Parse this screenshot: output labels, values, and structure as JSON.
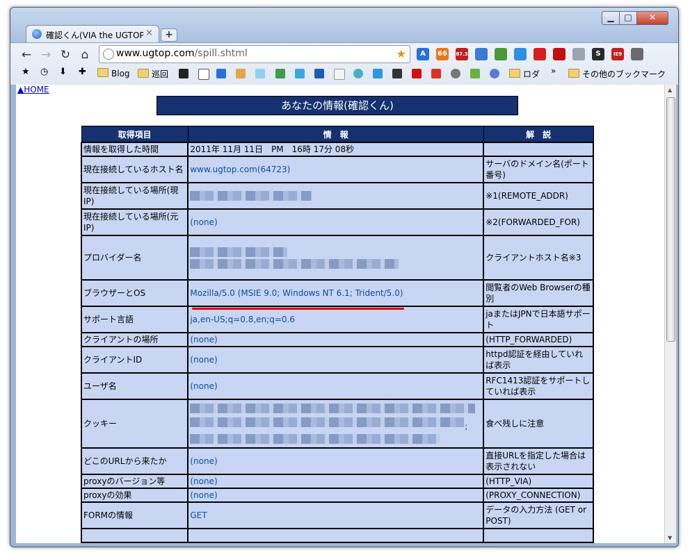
{
  "tab": {
    "title": "確認くん(VIA the UGTOP",
    "close": "×",
    "new": "+"
  },
  "window": {
    "min": "▁",
    "max": "□",
    "close": "✕"
  },
  "nav": {
    "back": "←",
    "forward": "→",
    "reload": "↻",
    "home": "⌂"
  },
  "address": {
    "domain": "www.ugtop.com",
    "path": "/spill.shtml"
  },
  "extensions": [
    {
      "icon": "translate-icon",
      "color": "#2a6fd1",
      "text": "A"
    },
    {
      "icon": "rss-icon",
      "color": "#e8771c",
      "text": "66"
    },
    {
      "icon": "count-icon",
      "color": "#c02020",
      "text": "87.3"
    },
    {
      "icon": "screenshot-icon",
      "color": "#3a7bd5",
      "text": ""
    },
    {
      "icon": "share-icon",
      "color": "#4a9a3a",
      "text": ""
    },
    {
      "icon": "sync-icon",
      "color": "#2f8fe0",
      "text": ""
    },
    {
      "icon": "opera-icon",
      "color": "#d62020",
      "text": ""
    },
    {
      "icon": "adblock-icon",
      "color": "#c01010",
      "text": ""
    },
    {
      "icon": "magnifier-icon",
      "color": "#9aa4b0",
      "text": ""
    },
    {
      "icon": "s-icon",
      "color": "#2a2a2a",
      "text": "S"
    },
    {
      "icon": "ie9-icon",
      "color": "#c42020",
      "text": "IE9"
    },
    {
      "icon": "wrench-icon",
      "color": "#6b6b6b",
      "text": ""
    }
  ],
  "bookmarks": {
    "blog": "Blog",
    "junkai": "巡回",
    "roda": "ロダ",
    "more": "»",
    "other": "その他のブックマーク"
  },
  "page": {
    "home_link": "▲HOME",
    "banner": "あなたの情報(確認くん)",
    "headers": [
      "取得項目",
      "情　報",
      "解　説"
    ],
    "rows": [
      {
        "item": "情報を取得した時間",
        "value": "2011年 11月 11日　PM　16時 17分 08秒",
        "desc": ""
      },
      {
        "item": "現在接続しているホスト名",
        "value": "www.ugtop.com(64723)",
        "desc": "サーバのドメイン名(ポート番号)"
      },
      {
        "item": "現在接続している場所(現IP)",
        "value": "",
        "desc": "※1(REMOTE_ADDR)"
      },
      {
        "item": "現在接続している場所(元IP)",
        "value": "(none)",
        "desc": "※2(FORWARDED_FOR)"
      },
      {
        "item": "プロバイダー名",
        "value": "",
        "desc": "クライアントホスト名※3"
      },
      {
        "item": "ブラウザーとOS",
        "value": "Mozilla/5.0 (MSIE 9.0; Windows NT 6.1; Trident/5.0)",
        "desc": "閲覧者のWeb Browserの種別"
      },
      {
        "item": "サポート言語",
        "value": "ja,en-US;q=0.8,en;q=0.6",
        "desc": "jaまたはJPNで日本語サポート"
      },
      {
        "item": "クライアントの場所",
        "value": "(none)",
        "desc": "(HTTP_FORWARDED)"
      },
      {
        "item": "クライアントID",
        "value": "(none)",
        "desc": "httpd認証を経由していれば表示"
      },
      {
        "item": "ユーザ名",
        "value": "(none)",
        "desc": "RFC1413認証をサポートしていれば表示"
      },
      {
        "item": "クッキー",
        "value": ";",
        "desc": "食べ残しに注意"
      },
      {
        "item": "どこのURLから来たか",
        "value": "(none)",
        "desc": "直接URLを指定した場合は表示されない"
      },
      {
        "item": "proxyのバージョン等",
        "value": "(none)",
        "desc": "(HTTP_VIA)"
      },
      {
        "item": "proxyの効果",
        "value": "(none)",
        "desc": "(PROXY_CONNECTION)"
      },
      {
        "item": "FORMの情報",
        "value": "GET",
        "desc": "データの入力方法 (GET or POST)"
      }
    ]
  },
  "colors": {
    "header_bg": "#15316f",
    "cell_bg": "#c8d6f3",
    "value_text": "#0b4da0",
    "highlight": "#e00000"
  }
}
